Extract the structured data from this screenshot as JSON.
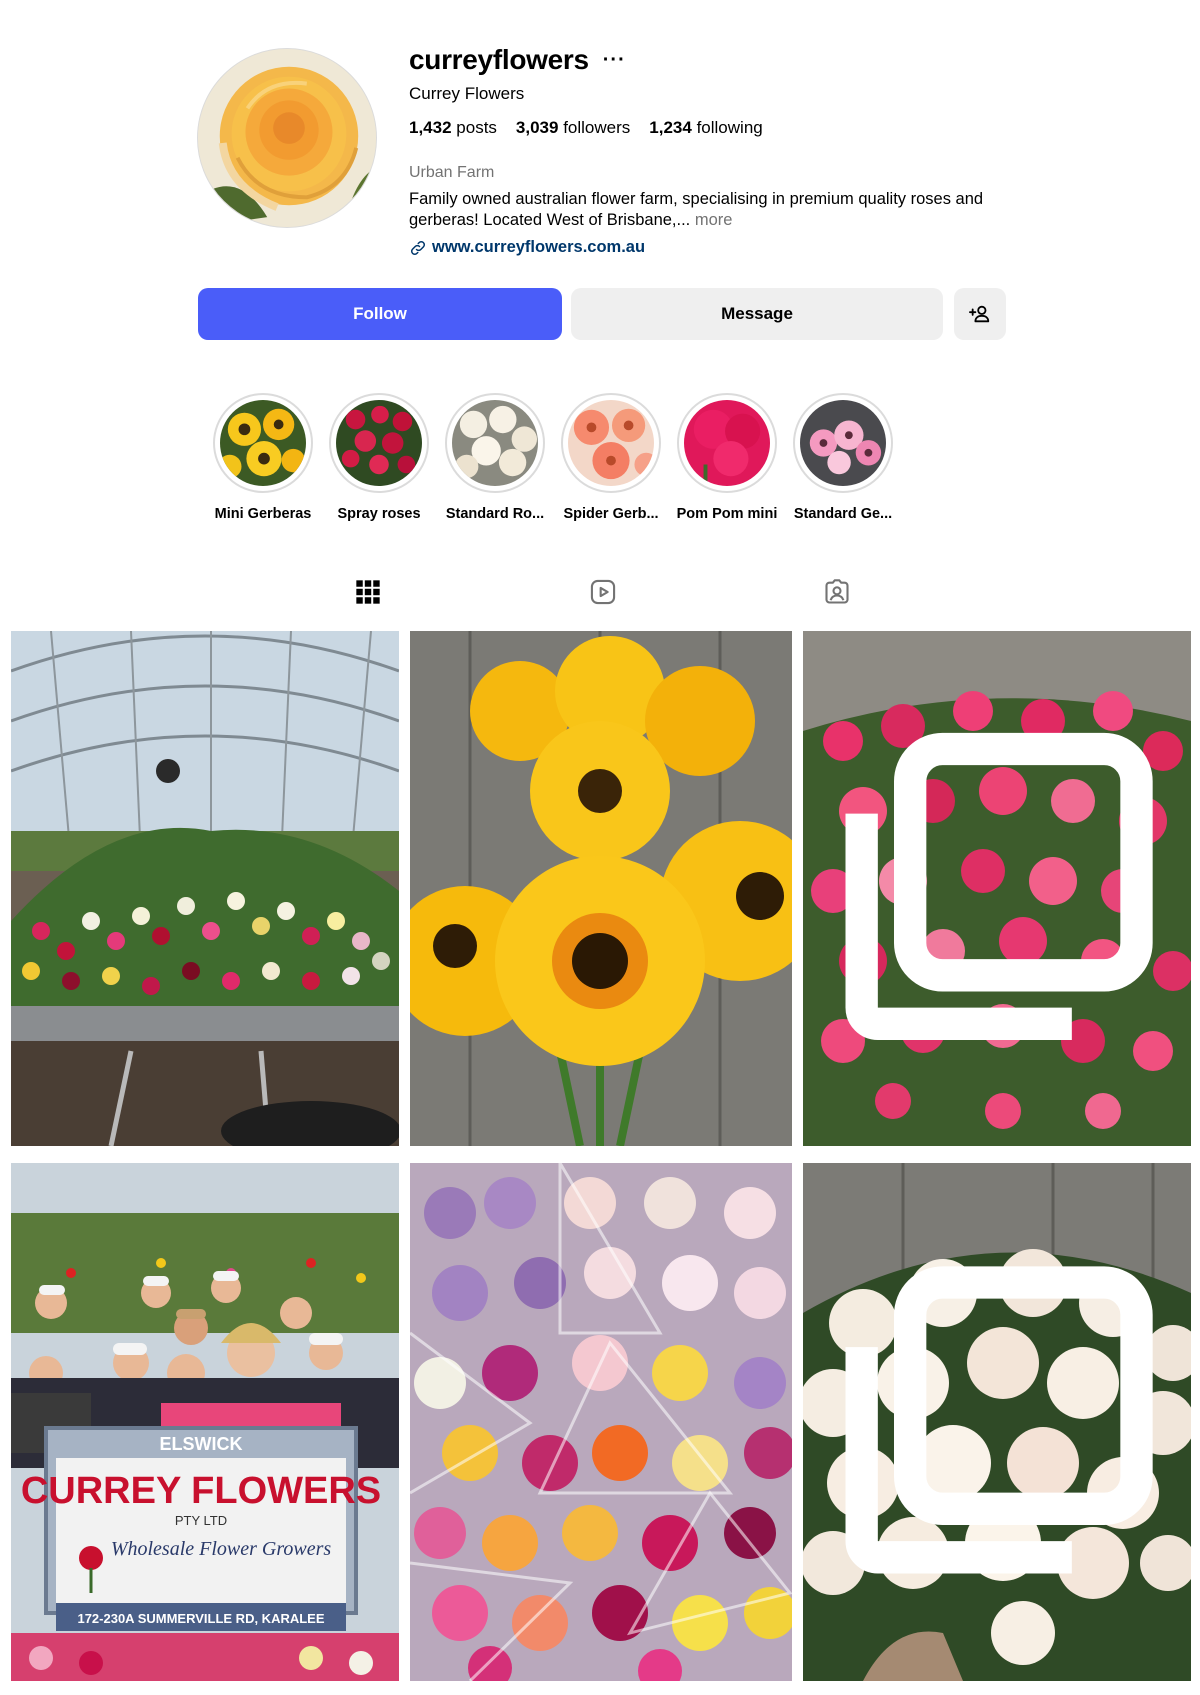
{
  "profile": {
    "username": "curreyflowers",
    "more_icon": "ellipsis-icon",
    "full_name": "Currey Flowers",
    "stats": {
      "posts_count": "1,432",
      "posts_label": "posts",
      "followers_count": "3,039",
      "followers_label": "followers",
      "following_count": "1,234",
      "following_label": "following"
    },
    "category": "Urban Farm",
    "bio": "Family owned australian flower farm, specialising in premium quality roses and gerberas! Located West of Brisbane,...",
    "bio_more": "more",
    "link_icon": "link-icon",
    "website": "www.curreyflowers.com.au"
  },
  "actions": {
    "follow_label": "Follow",
    "message_label": "Message",
    "suggest_icon": "add-person-icon"
  },
  "highlights": [
    {
      "label": "Mini Gerberas"
    },
    {
      "label": "Spray roses"
    },
    {
      "label": "Standard Ro..."
    },
    {
      "label": "Spider Gerb..."
    },
    {
      "label": "Pom Pom mini"
    },
    {
      "label": "Standard Ge..."
    }
  ],
  "tabs": [
    {
      "icon": "grid-icon",
      "active": true
    },
    {
      "icon": "reels-icon",
      "active": false
    },
    {
      "icon": "tagged-icon",
      "active": false
    }
  ],
  "posts": [
    {
      "subject": "greenhouse roses on trolley",
      "multi": false
    },
    {
      "subject": "yellow gerberas",
      "multi": false
    },
    {
      "subject": "pink spray roses",
      "multi": true
    },
    {
      "subject": "staff group with Currey Flowers sign",
      "multi": false,
      "sign": {
        "line1": "ELSWICK",
        "line2": "CURREY FLOWERS",
        "line3": "PTY LTD",
        "line4": "Wholesale Flower Growers",
        "line5": "172-230A SUMMERVILLE RD, KARALEE"
      }
    },
    {
      "subject": "wrapped rose bunches",
      "multi": false
    },
    {
      "subject": "white roses bouquet",
      "multi": true
    }
  ],
  "colors": {
    "follow_button": "#4a5df9",
    "secondary_button": "#efefef",
    "link": "#00376b",
    "muted_text": "#737373"
  }
}
